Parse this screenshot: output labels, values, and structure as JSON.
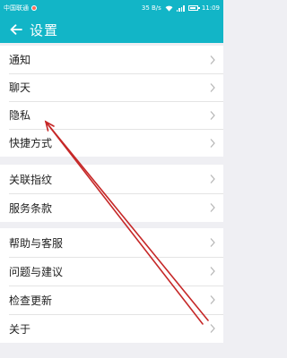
{
  "status_bar": {
    "carrier": "中国联通",
    "speed": "35 B/s",
    "time": "11:09",
    "colors": {
      "bar": "#12b5c7",
      "alert_dot": "#ff6b57"
    }
  },
  "header": {
    "title": "设置",
    "back_icon": "arrow-left-icon"
  },
  "groups": [
    {
      "items": [
        {
          "label": "通知"
        },
        {
          "label": "聊天"
        },
        {
          "label": "隐私"
        },
        {
          "label": "快捷方式"
        }
      ]
    },
    {
      "items": [
        {
          "label": "关联指纹"
        },
        {
          "label": "服务条款"
        }
      ]
    },
    {
      "items": [
        {
          "label": "帮助与客服"
        },
        {
          "label": "问题与建议"
        },
        {
          "label": "检查更新"
        },
        {
          "label": "关于"
        }
      ]
    }
  ],
  "annotation": {
    "color": "#c62828",
    "points_to": "隐私"
  }
}
